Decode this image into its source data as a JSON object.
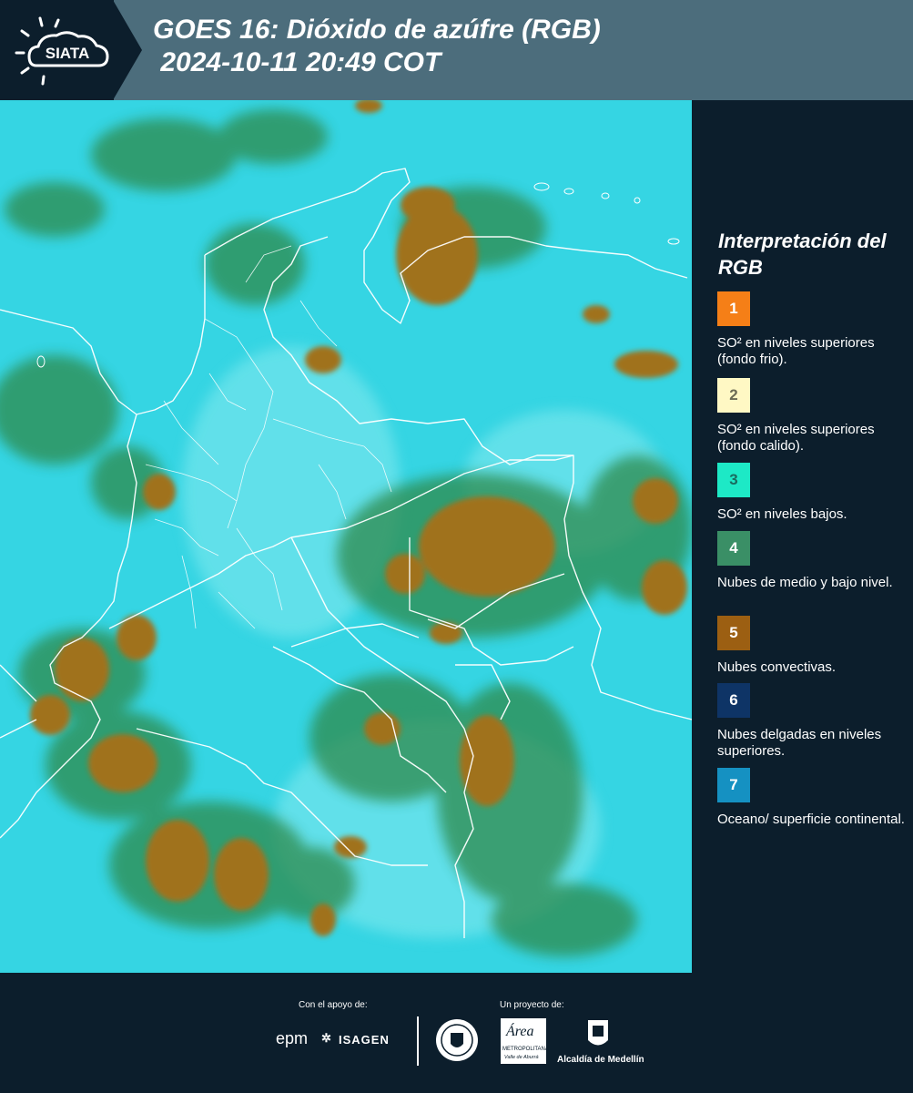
{
  "header": {
    "logo_text": "SIATA",
    "title_line1": "GOES 16: Dióxido de azúfre (RGB)",
    "title_line2": " 2024-10-11 20:49 COT"
  },
  "legend": {
    "title": "Interpretación del RGB",
    "items": [
      {
        "number": "1",
        "label": "SO² en niveles superiores (fondo frio).",
        "color": "#f57f17"
      },
      {
        "number": "2",
        "label": "SO² en niveles superiores (fondo calido).",
        "color": "#fff8c4"
      },
      {
        "number": "3",
        "label": "SO² en niveles bajos.",
        "color": "#1de9c6"
      },
      {
        "number": "4",
        "label": "Nubes de medio y bajo nivel.",
        "color": "#3a8f66"
      },
      {
        "number": "5",
        "label": "Nubes convectivas.",
        "color": "#9c5f12"
      },
      {
        "number": "6",
        "label": "Nubes delgadas en niveles superiores.",
        "color": "#0e3466"
      },
      {
        "number": "7",
        "label": "Oceano/ superficie continental.",
        "color": "#1591c2"
      }
    ]
  },
  "footer": {
    "support_label": "Con el apoyo de:",
    "project_label": "Un proyecto de:",
    "sponsor_epm": "epm",
    "sponsor_isagen": "ISAGEN",
    "area_metro_text": "Área",
    "area_metro_subtext": "METROPOLITANA",
    "area_metro_subtext2": "Valle de Aburrá",
    "alcaldia": "Alcaldía de Medellín"
  },
  "colors": {
    "background": "#0c1e2c",
    "header_band": "#4c6d7c",
    "map_cyan": "#35d5e3",
    "cloud_green": "#2f8a4c",
    "convective_brown": "#a0721e"
  }
}
